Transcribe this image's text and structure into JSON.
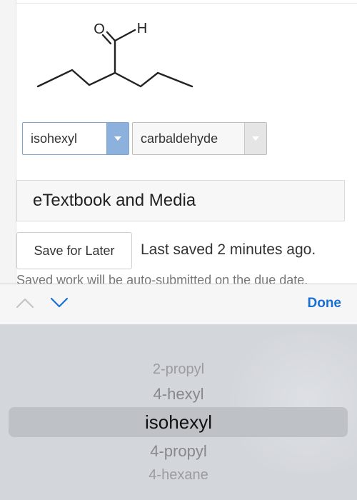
{
  "molecule": {
    "oxygen_label": "O",
    "hydrogen_label": "H"
  },
  "selects": {
    "prefix_value": "isohexyl",
    "suffix_value": "carbaldehyde"
  },
  "media": {
    "label": "eTextbook and Media"
  },
  "save": {
    "button_label": "Save for Later",
    "last_saved": "Last saved 2 minutes ago.",
    "auto_submit": "Saved work will be auto-submitted on the due date."
  },
  "toolbar": {
    "done_label": "Done",
    "icons": [
      "chevron-up-icon",
      "chevron-down-icon"
    ],
    "accent_color": "#1a6fd6"
  },
  "picker": {
    "options": [
      "2-propyl",
      "4-hexyl",
      "isohexyl",
      "4-propyl",
      "4-hexane"
    ],
    "selected": "isohexyl"
  }
}
